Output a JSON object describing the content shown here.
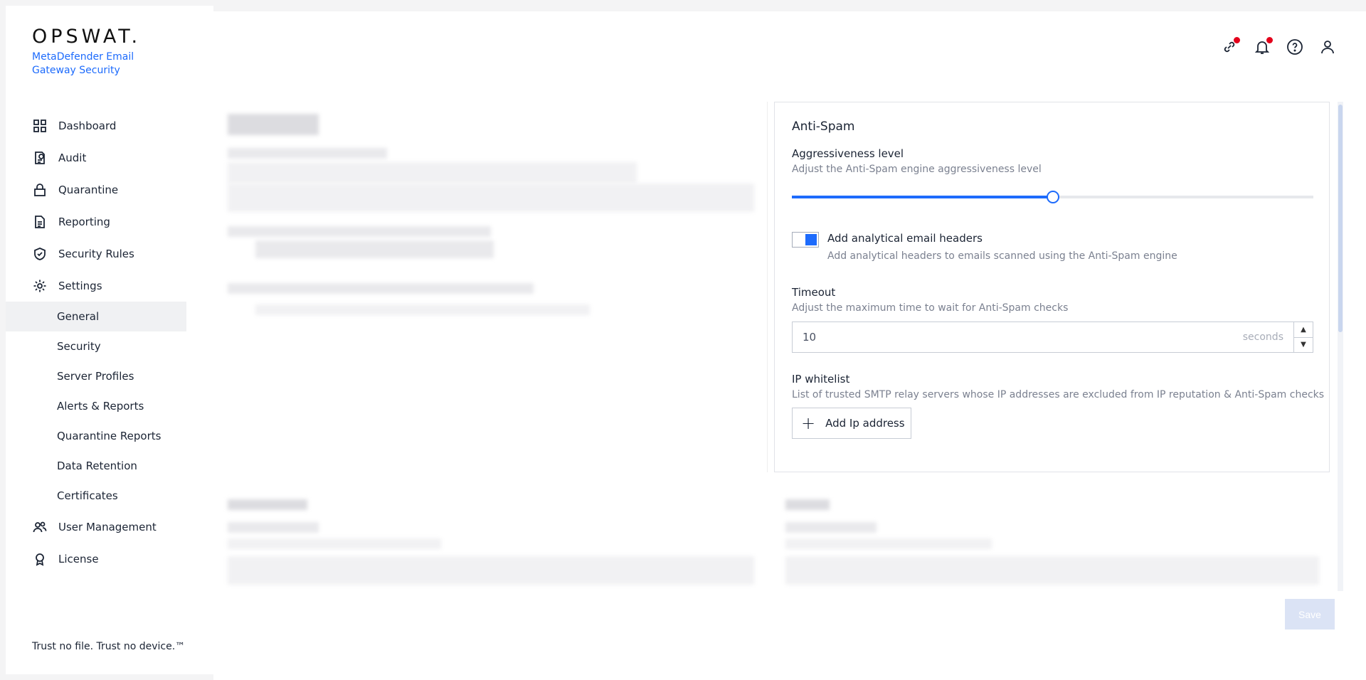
{
  "brand": {
    "logo": "OPSWAT.",
    "product": "MetaDefender Email Gateway Security",
    "tagline": "Trust no file. Trust no device.™"
  },
  "nav": {
    "dashboard": "Dashboard",
    "audit": "Audit",
    "quarantine": "Quarantine",
    "reporting": "Reporting",
    "security_rules": "Security Rules",
    "settings": "Settings",
    "sub": {
      "general": "General",
      "security": "Security",
      "server_profiles": "Server Profiles",
      "alerts_reports": "Alerts & Reports",
      "quarantine_reports": "Quarantine Reports",
      "data_retention": "Data Retention",
      "certificates": "Certificates"
    },
    "user_management": "User Management",
    "license": "License"
  },
  "header_icons": [
    "link-icon",
    "bell-icon",
    "help-icon",
    "user-icon"
  ],
  "anti_spam": {
    "title": "Anti-Spam",
    "aggressiveness": {
      "label": "Aggressiveness level",
      "desc": "Adjust the Anti-Spam engine aggressiveness level",
      "value_fraction": 0.5
    },
    "headers": {
      "label": "Add analytical email headers",
      "desc": "Add analytical headers to emails scanned using the Anti-Spam engine",
      "checked": true
    },
    "timeout": {
      "label": "Timeout",
      "desc": "Adjust the maximum time to wait for Anti-Spam checks",
      "value": "10",
      "unit": "seconds"
    },
    "ip_whitelist": {
      "label": "IP whitelist",
      "desc": "List of trusted SMTP relay servers whose IP addresses are excluded from IP reputation & Anti-Spam checks",
      "add_label": "Add Ip address"
    }
  },
  "save_label": "Save",
  "colors": {
    "accent": "#1d6bfc",
    "notification": "#e3001b"
  }
}
